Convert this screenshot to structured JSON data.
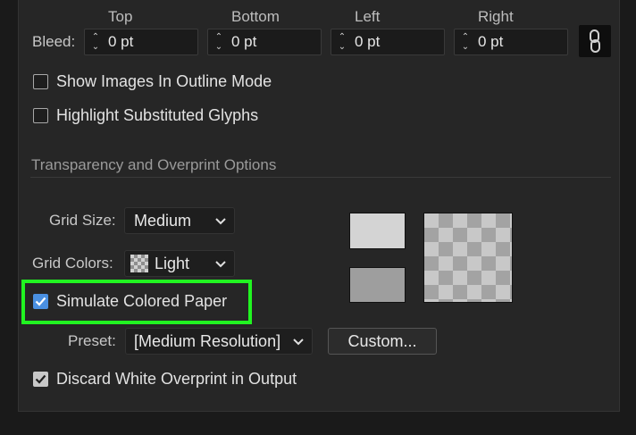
{
  "bleed": {
    "label": "Bleed:",
    "columns": [
      {
        "header": "Top",
        "value": "0 pt"
      },
      {
        "header": "Bottom",
        "value": "0 pt"
      },
      {
        "header": "Left",
        "value": "0 pt"
      },
      {
        "header": "Right",
        "value": "0 pt"
      }
    ],
    "link_icon": "chain-link-icon"
  },
  "options": {
    "show_images_outline": {
      "label": "Show Images In Outline Mode",
      "checked": false
    },
    "highlight_glyphs": {
      "label": "Highlight Substituted Glyphs",
      "checked": false
    }
  },
  "transparency": {
    "section_title": "Transparency and Overprint Options",
    "grid_size": {
      "label": "Grid Size:",
      "value": "Medium"
    },
    "grid_colors": {
      "label": "Grid Colors:",
      "value": "Light"
    },
    "simulate_paper": {
      "label": "Simulate Colored Paper",
      "checked": true
    },
    "preset": {
      "label": "Preset:",
      "value": "[Medium Resolution]"
    },
    "custom_button": "Custom...",
    "discard_white": {
      "label": "Discard White Overprint in Output",
      "checked": true
    },
    "swatch_colors": {
      "light": "#d4d4d4",
      "dark": "#9e9e9e"
    }
  },
  "colors": {
    "accent_checkbox": "#4a90e2",
    "highlight": "#21f421"
  }
}
